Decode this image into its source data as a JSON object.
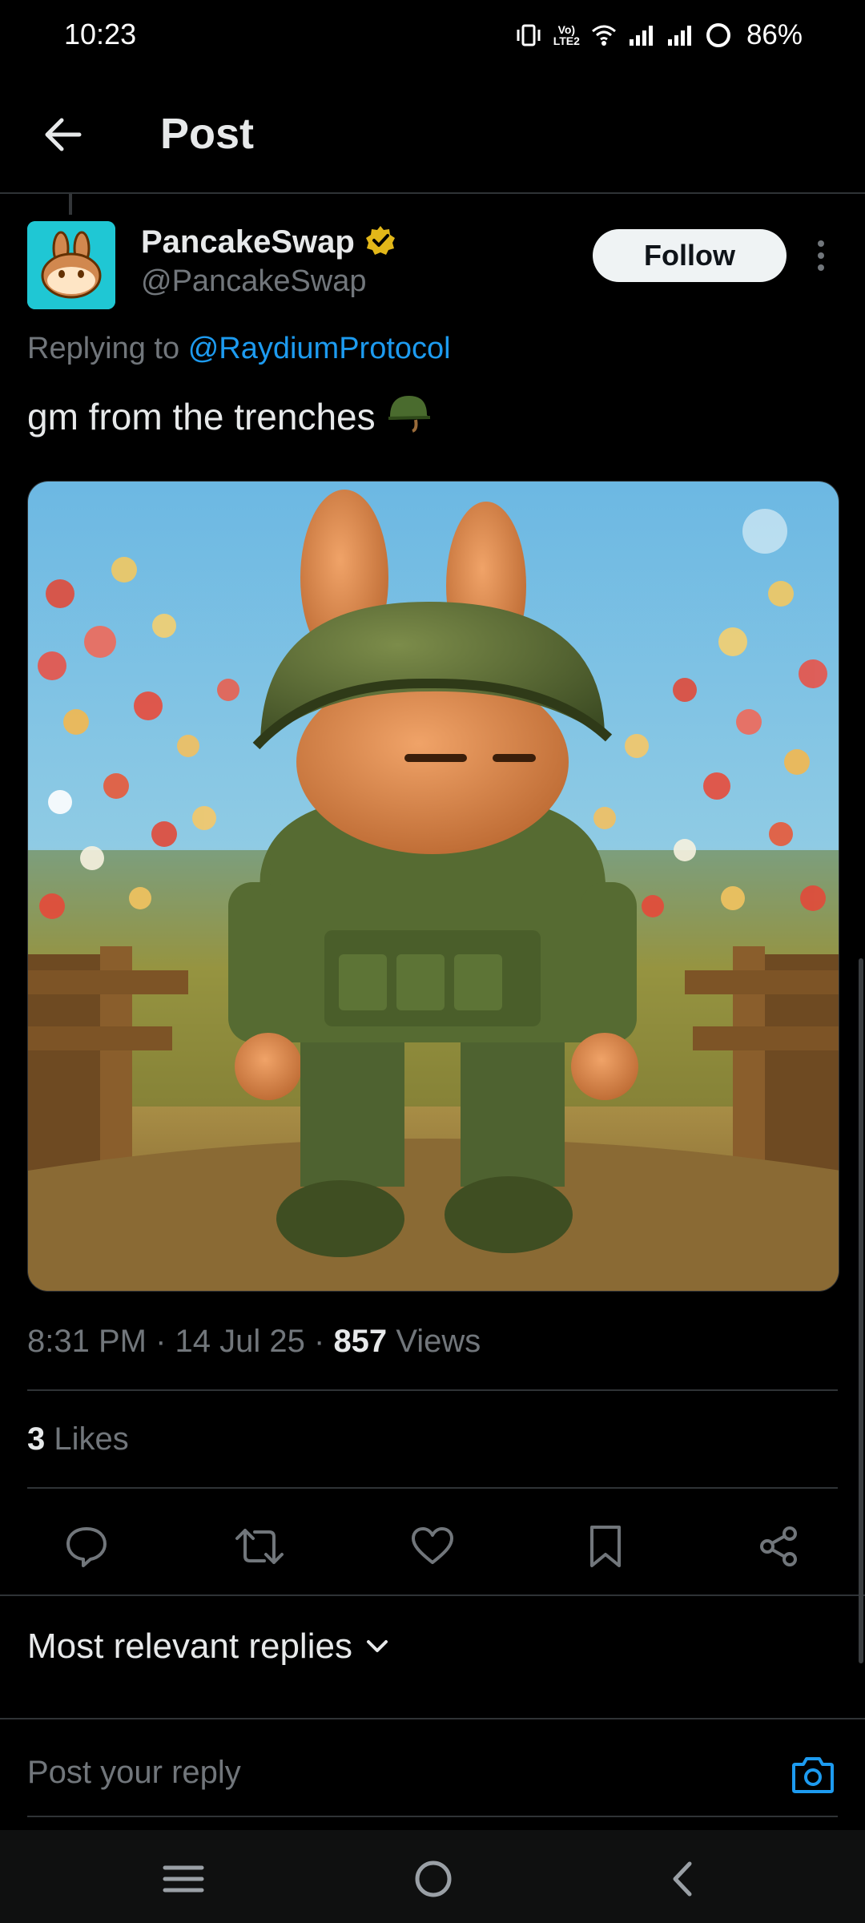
{
  "status_bar": {
    "time": "10:23",
    "battery": "86%",
    "volte_top": "Vo)",
    "volte_bottom": "LTE2",
    "icons": [
      "vibrate-icon",
      "volte-icon",
      "wifi-icon",
      "signal-1-icon",
      "signal-2-icon",
      "battery-ring-icon"
    ]
  },
  "header": {
    "title": "Post",
    "back_icon": "arrow-left-icon"
  },
  "author": {
    "name": "PancakeSwap",
    "handle": "@PancakeSwap",
    "verified_badge_color": "#e2b719",
    "avatar_color": "#1fc7d4",
    "follow_label": "Follow"
  },
  "post": {
    "replying_prefix": "Replying to",
    "replying_to": "@RaydiumProtocol",
    "text": "gm from the trenches",
    "emoji": "military-helmet-emoji",
    "image_alt_subject": "3D bunny figure in green soldier uniform standing in a trench among flowers",
    "time": "8:31 PM",
    "date": "14 Jul 25",
    "views_count": "857",
    "views_label": "Views",
    "likes_count": "3",
    "likes_label": "Likes"
  },
  "actions": [
    {
      "name": "reply",
      "icon": "speech-bubble-icon"
    },
    {
      "name": "repost",
      "icon": "repost-arrows-icon"
    },
    {
      "name": "like",
      "icon": "heart-icon"
    },
    {
      "name": "bookmark",
      "icon": "bookmark-icon"
    },
    {
      "name": "share",
      "icon": "share-icon"
    }
  ],
  "replies": {
    "sort_label": "Most relevant replies",
    "composer_placeholder": "Post your reply"
  },
  "colors": {
    "background": "#000000",
    "text_primary": "#e7e9ea",
    "text_secondary": "#71767b",
    "accent": "#1d9bf0",
    "divider": "#2f3336"
  },
  "nav_bar": {
    "buttons": [
      "recents-icon",
      "home-circle-icon",
      "back-chevron-icon"
    ]
  }
}
